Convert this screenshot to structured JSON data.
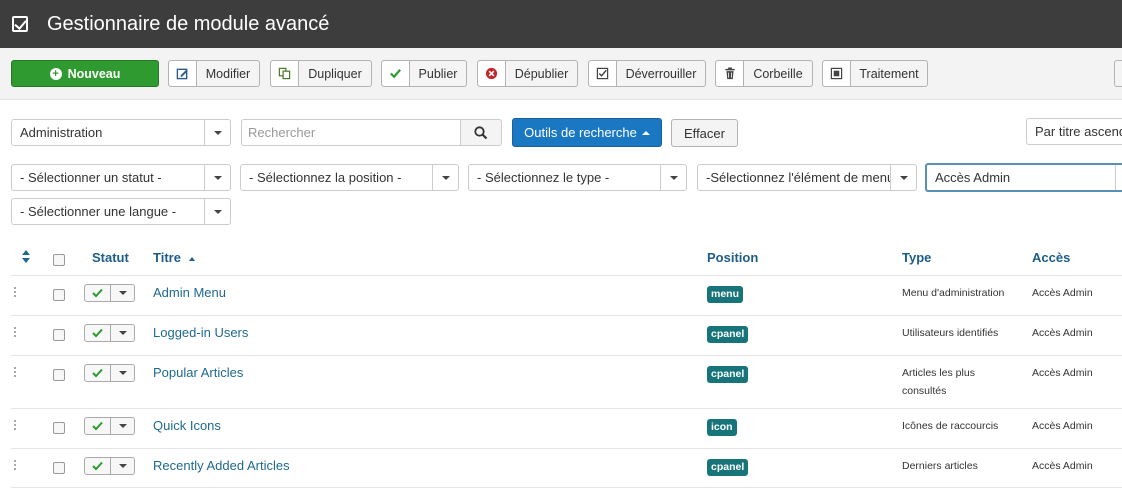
{
  "header": {
    "title": "Gestionnaire de module avancé",
    "icon": "checkbox-icon"
  },
  "toolbar": {
    "new_label": "Nouveau",
    "buttons": [
      {
        "label": "Modifier",
        "icon": "edit-icon"
      },
      {
        "label": "Dupliquer",
        "icon": "copy-icon"
      },
      {
        "label": "Publier",
        "icon": "check-icon"
      },
      {
        "label": "Dépublier",
        "icon": "unpublish-icon"
      },
      {
        "label": "Déverrouiller",
        "icon": "checkin-icon"
      },
      {
        "label": "Corbeille",
        "icon": "trash-icon"
      },
      {
        "label": "Traitement",
        "icon": "batch-icon"
      }
    ]
  },
  "filters": {
    "client": "Administration",
    "search_placeholder": "Rechercher",
    "tools_label": "Outils de recherche",
    "clear_label": "Effacer",
    "sort": "Par titre ascendant",
    "status": "- Sélectionner un statut -",
    "position": "- Sélectionnez la position -",
    "type": "- Sélectionnez le type -",
    "menu_item": "-Sélectionnez l'élément de menu-",
    "access": "Accès Admin",
    "language": "- Sélectionner une langue -"
  },
  "table": {
    "headers": {
      "status": "Statut",
      "title": "Titre",
      "position": "Position",
      "type": "Type",
      "access": "Accès"
    },
    "rows": [
      {
        "title": "Admin Menu",
        "position": "menu",
        "type_lines": [
          "Menu d'administration",
          ""
        ],
        "access": "Accès Admin"
      },
      {
        "title": "Logged-in Users",
        "position": "cpanel",
        "type_lines": [
          "Utilisateurs identifiés",
          ""
        ],
        "access": "Accès Admin"
      },
      {
        "title": "Popular Articles",
        "position": "cpanel",
        "type_lines": [
          "Articles les plus",
          "consultés"
        ],
        "access": "Accès Admin"
      },
      {
        "title": "Quick Icons",
        "position": "icon",
        "type_lines": [
          "Icônes de raccourcis",
          ""
        ],
        "access": "Accès Admin"
      },
      {
        "title": "Recently Added Articles",
        "position": "cpanel",
        "type_lines": [
          "Derniers articles",
          ""
        ],
        "access": "Accès Admin"
      }
    ]
  },
  "colors": {
    "header_bg": "#3d3d3d",
    "new_button": "#2f9a2f",
    "primary": "#1a78c2",
    "badge": "#17757a",
    "link": "#1e6a8e"
  }
}
